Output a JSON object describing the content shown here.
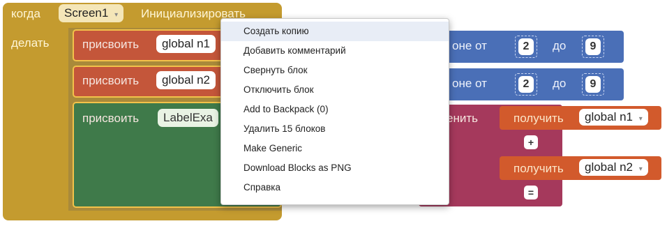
{
  "event_block": {
    "when": "когда",
    "component": "Screen1",
    "event": "Инициализировать",
    "do": "делать"
  },
  "statements": [
    {
      "set": "присвоить",
      "var": "global n1"
    },
    {
      "set": "присвоить",
      "var": "global n2"
    },
    {
      "set": "присвоить",
      "var": "LabelExa"
    }
  ],
  "random_blocks": [
    {
      "range_from": "оне от",
      "from": "2",
      "to_label": "до",
      "to": "9"
    },
    {
      "range_from": "оне от",
      "from": "2",
      "to_label": "до",
      "to": "9"
    }
  ],
  "join_block": {
    "label": "енить"
  },
  "get_blocks": [
    {
      "get": "получить",
      "var": "global n1"
    },
    {
      "get": "получить",
      "var": "global n2"
    }
  ],
  "operators": [
    "+",
    "="
  ],
  "context_menu": {
    "items": [
      "Создать копию",
      "Добавить комментарий",
      "Свернуть блок",
      "Отключить блок",
      "Add to Backpack (0)",
      "Удалить 15 блоков",
      "Make Generic",
      "Download Blocks as PNG",
      "Справка"
    ],
    "highlighted_index": 0
  },
  "colors": {
    "event": "#c49b2f",
    "set_block": "#c4563a",
    "text_set_block": "#3f7a4a",
    "math_random": "#4a6fb7",
    "text_join": "#a5395c",
    "get_block": "#d25a2c",
    "highlight": "#f2c24a"
  }
}
